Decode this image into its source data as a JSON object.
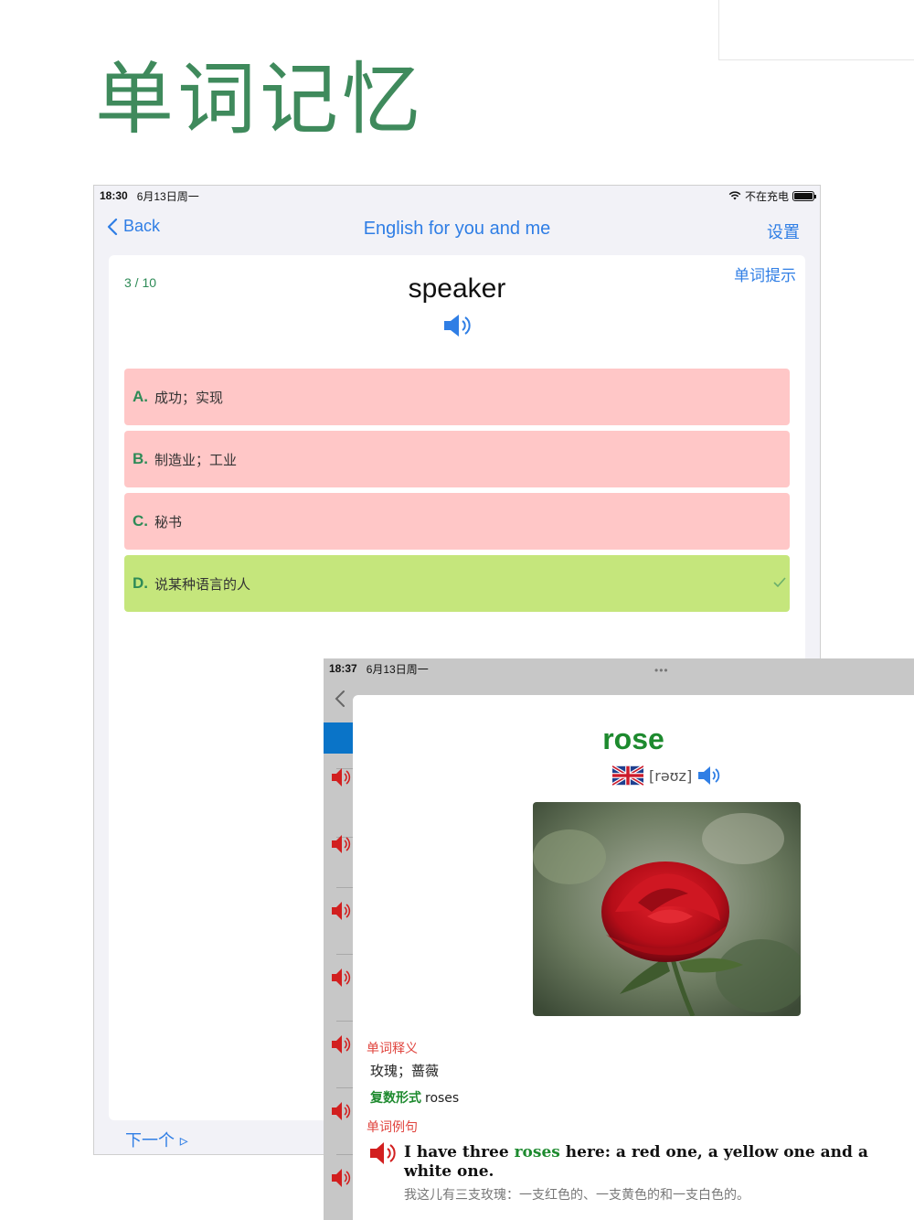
{
  "hero": {
    "title": "单词记忆"
  },
  "device1": {
    "status": {
      "time": "18:30",
      "date": "6月13日周一",
      "charging": "不在充电"
    },
    "nav": {
      "back_label": "Back",
      "title": "English for you and me",
      "settings_label": "设置"
    },
    "quiz": {
      "progress": "3 / 10",
      "hint_label": "单词提示",
      "word": "speaker",
      "options": [
        {
          "letter": "A.",
          "text": "成功；实现",
          "state": "wrong"
        },
        {
          "letter": "B.",
          "text": "制造业；工业",
          "state": "wrong"
        },
        {
          "letter": "C.",
          "text": "秘书",
          "state": "wrong"
        },
        {
          "letter": "D.",
          "text": "说某种语言的人",
          "state": "correct"
        }
      ],
      "next_label": "下一个 ▹"
    }
  },
  "device2": {
    "status": {
      "time": "18:37",
      "date": "6月13日周一"
    },
    "word": "rose",
    "phonetic": "[rəʊz]",
    "meaning_label": "单词释义",
    "meaning": "玫瑰；蔷薇",
    "plural_label": "复数形式",
    "plural_value": "roses",
    "example_label": "单词例句",
    "example": {
      "before": "I have three ",
      "highlight": "roses",
      "after": " here: a red one, a yellow one and a white one."
    },
    "example_translation": "我这儿有三支玫瑰：一支红色的、一支黄色的和一支白色的。"
  },
  "colors": {
    "accent_blue": "#2f7ee5",
    "green": "#2e8b57",
    "wrong_bg": "#ffc7c7",
    "correct_bg": "#c5e67c",
    "label_red": "#e0443e"
  }
}
